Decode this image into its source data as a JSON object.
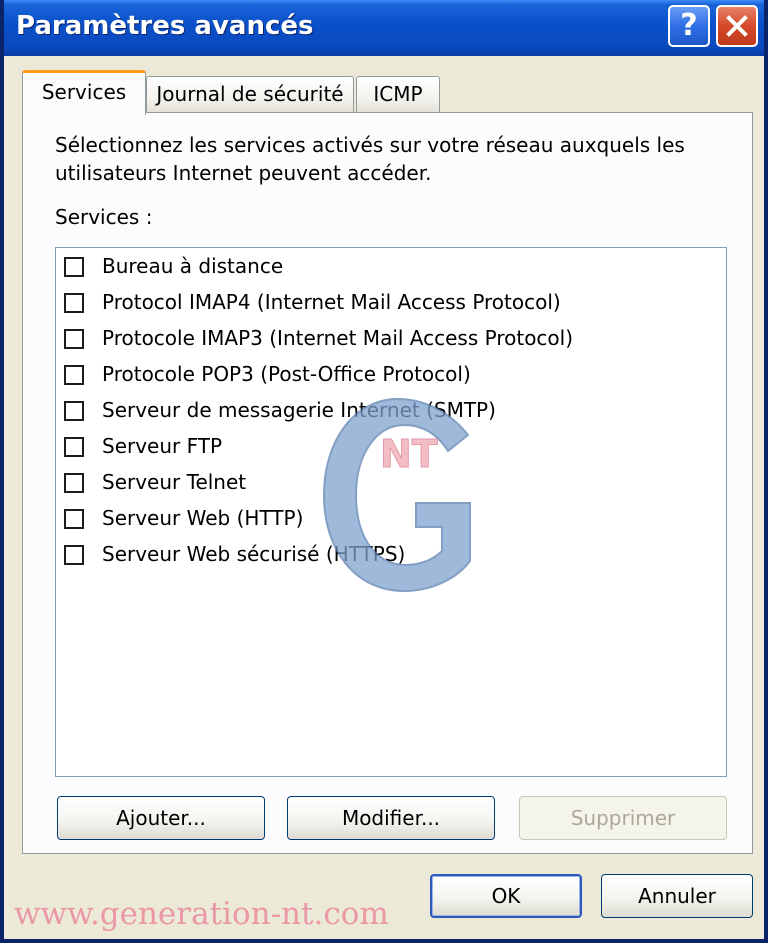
{
  "window": {
    "title": "Paramètres avancés",
    "help_label": "?"
  },
  "tabs": [
    {
      "label": "Services",
      "active": true
    },
    {
      "label": "Journal de sécurité",
      "active": false
    },
    {
      "label": "ICMP",
      "active": false
    }
  ],
  "panel": {
    "description": "Sélectionnez les services activés sur votre réseau auxquels les utilisateurs Internet peuvent accéder.",
    "services_label": "Services :",
    "services": [
      {
        "label": "Bureau à distance",
        "checked": false
      },
      {
        "label": "Protocol IMAP4 (Internet Mail Access Protocol)",
        "checked": false
      },
      {
        "label": "Protocole IMAP3 (Internet Mail Access Protocol)",
        "checked": false
      },
      {
        "label": "Protocole POP3 (Post-Office Protocol)",
        "checked": false
      },
      {
        "label": "Serveur de messagerie Internet (SMTP)",
        "checked": false
      },
      {
        "label": "Serveur FTP",
        "checked": false
      },
      {
        "label": "Serveur Telnet",
        "checked": false
      },
      {
        "label": "Serveur Web (HTTP)",
        "checked": false
      },
      {
        "label": "Serveur Web sécurisé (HTTPS)",
        "checked": false
      }
    ],
    "buttons": {
      "add": "Ajouter...",
      "modify": "Modifier...",
      "delete": "Supprimer"
    }
  },
  "footer": {
    "ok": "OK",
    "cancel": "Annuler"
  },
  "watermark": {
    "logo_text": "NT",
    "url": "www.generation-nt.com"
  },
  "colors": {
    "titlebar": "#0a4fc9",
    "active_tab_accent": "#ff9a1e",
    "window_bg": "#ece9d8",
    "disabled_text": "#aca899"
  }
}
